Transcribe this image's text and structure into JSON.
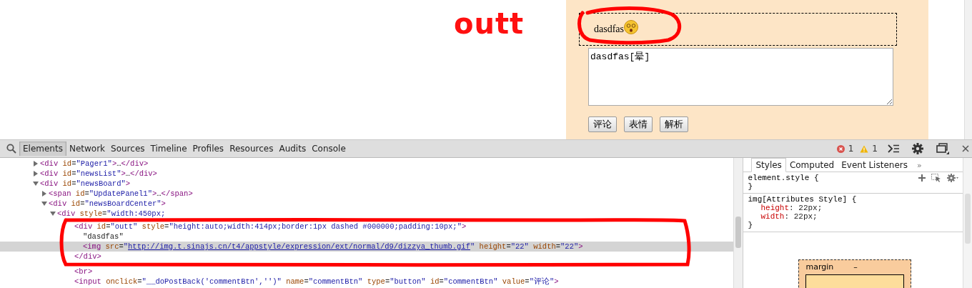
{
  "page": {
    "annotation": "outt",
    "outt_text": "dasdfas",
    "comment_text": "dasdfas[晕]",
    "buttons": [
      {
        "label": "评论"
      },
      {
        "label": "表情"
      },
      {
        "label": "解析"
      }
    ]
  },
  "devtools": {
    "tabs": [
      {
        "label": "Elements",
        "selected": true
      },
      {
        "label": "Network",
        "selected": false
      },
      {
        "label": "Sources",
        "selected": false
      },
      {
        "label": "Timeline",
        "selected": false
      },
      {
        "label": "Profiles",
        "selected": false
      },
      {
        "label": "Resources",
        "selected": false
      },
      {
        "label": "Audits",
        "selected": false
      },
      {
        "label": "Console",
        "selected": false
      }
    ],
    "error_count": "1",
    "warning_count": "1"
  },
  "elements_tree": [
    {
      "kind": "element",
      "markup": "<div id=\"Pager1\">…</div>",
      "expanded": false,
      "selected": false
    },
    {
      "kind": "element",
      "markup": "<div id=\"newsList\">…</div>",
      "expanded": false,
      "selected": false
    },
    {
      "kind": "element",
      "markup": "<div id=\"newsBoard\">",
      "expanded": true,
      "selected": false,
      "children": [
        {
          "kind": "element",
          "markup": "<span id=\"UpdatePanel1\">…</span>",
          "expanded": false,
          "selected": false
        },
        {
          "kind": "element",
          "markup": "<div id=\"newsBoardCenter\">",
          "expanded": true,
          "selected": false,
          "children": [
            {
              "kind": "element",
              "markup": "<div style=\"width:450px;",
              "expanded": true,
              "selected": false,
              "children": [
                {
                  "kind": "element",
                  "markup": "<div id=\"outt\" style=\"height:auto;width:414px;border:1px dashed #000000;padding:10px;\">",
                  "selected": false,
                  "closing_tag": "</div>",
                  "children": [
                    {
                      "kind": "text",
                      "markup": "\"dasdfas\"",
                      "selected": false
                    },
                    {
                      "kind": "element",
                      "markup": "<img src=\"http://img.t.sinajs.cn/t4/appstyle/expression/ext/normal/d9/dizzya_thumb.gif\" height=\"22\" width=\"22\">",
                      "link": true,
                      "selected": true
                    }
                  ]
                },
                {
                  "kind": "element",
                  "markup": "<br>",
                  "selected": false
                },
                {
                  "kind": "element",
                  "markup": "<input onclick=\"__doPostBack('commentBtn','')\" name=\"commentBtn\" type=\"button\" id=\"commentBtn\" value=\"评论\">",
                  "selected": false
                }
              ]
            }
          ]
        }
      ]
    }
  ],
  "styles_pane": {
    "tabs": [
      {
        "label": "Styles",
        "selected": true
      },
      {
        "label": "Computed",
        "selected": false
      },
      {
        "label": "Event Listeners",
        "selected": false
      }
    ],
    "more": "»",
    "rules": [
      {
        "selector": "element.style",
        "open": "{",
        "close": "}"
      },
      {
        "selector": "img[Attributes Style]",
        "open": "{",
        "close": "}",
        "declarations": [
          {
            "property": "height",
            "separator": ":",
            "value": "22px;"
          },
          {
            "property": "width",
            "separator": ":",
            "value": "22px;"
          }
        ]
      }
    ],
    "box_model": {
      "label": "margin",
      "value": "–"
    }
  }
}
